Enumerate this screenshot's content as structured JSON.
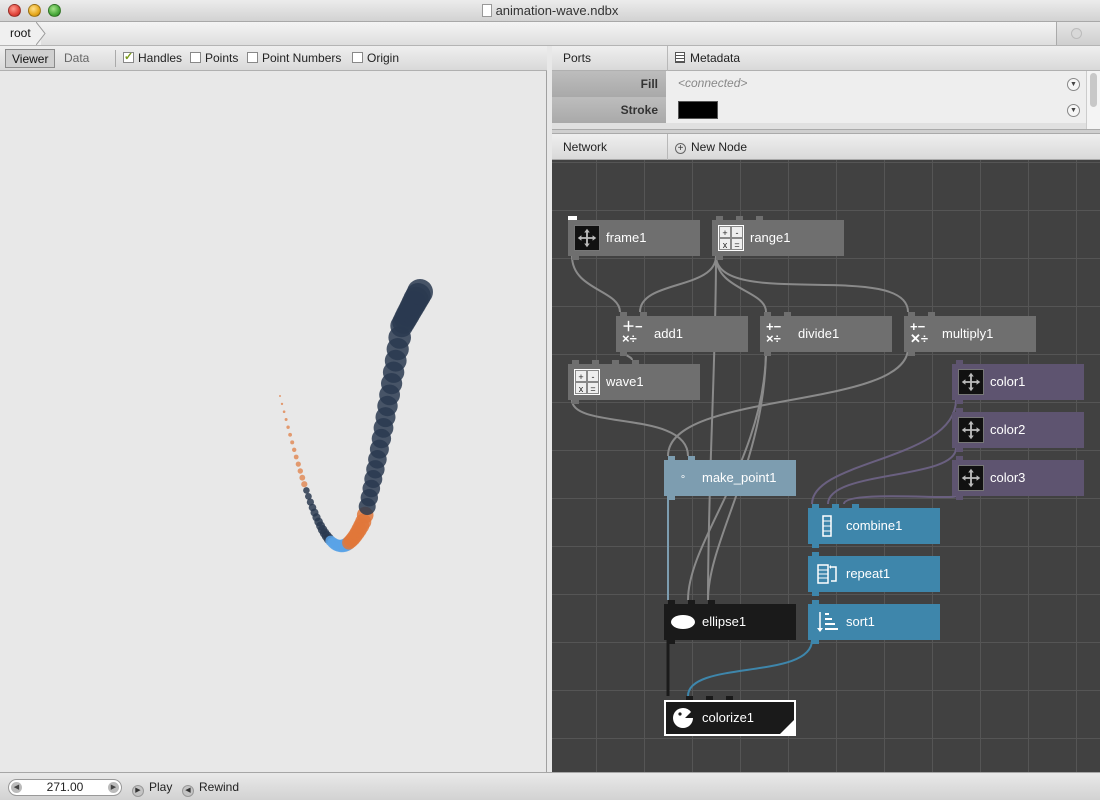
{
  "window": {
    "title": "animation-wave.ndbx"
  },
  "breadcrumb": {
    "root": "root"
  },
  "viewer": {
    "tabs": [
      "Viewer",
      "Data"
    ],
    "options": [
      {
        "label": "Handles",
        "checked": true
      },
      {
        "label": "Points",
        "checked": false
      },
      {
        "label": "Point Numbers",
        "checked": false
      },
      {
        "label": "Origin",
        "checked": false
      }
    ]
  },
  "ports": {
    "title": "Ports",
    "metadata_label": "Metadata",
    "rows": [
      {
        "name": "Fill",
        "value": "<connected>"
      },
      {
        "name": "Stroke",
        "value": "",
        "swatch_color": "#000000"
      }
    ]
  },
  "network": {
    "title": "Network",
    "new_node_label": "New Node",
    "nodes": {
      "frame1": "frame1",
      "range1": "range1",
      "add1": "add1",
      "divide1": "divide1",
      "multiply1": "multiply1",
      "wave1": "wave1",
      "color1": "color1",
      "color2": "color2",
      "color3": "color3",
      "make_point1": "make_point1",
      "combine1": "combine1",
      "repeat1": "repeat1",
      "ellipse1": "ellipse1",
      "sort1": "sort1",
      "colorize1": "colorize1"
    }
  },
  "playback": {
    "frame": "271.00",
    "play_label": "Play",
    "rewind_label": "Rewind"
  },
  "colors": {
    "node_gray": "#6f6f6f",
    "node_purple": "#5e5470",
    "node_teal": "#7d9db0",
    "node_blue": "#3e86ab",
    "node_black": "#1a1a1a",
    "wave_dark": "#2a3a50",
    "wave_blue": "#5ba3e6",
    "wave_orange": "#e0773a"
  }
}
